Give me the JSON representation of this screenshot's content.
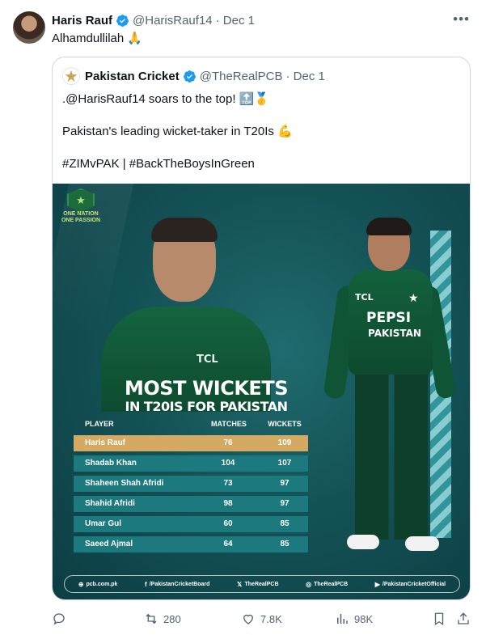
{
  "tweet": {
    "author_name": "Haris Rauf",
    "author_handle": "@HarisRauf14",
    "date": "· Dec 1",
    "text": "Alhamdullilah 🙏",
    "more_icon": "more-icon"
  },
  "quote": {
    "author_name": "Pakistan Cricket",
    "author_handle": "@TheRealPCB",
    "date": "· Dec 1",
    "line1": ".@HarisRauf14 soars to the top! 🔝🥇",
    "line2": "Pakistan's leading wicket-taker in T20Is 💪",
    "line3": "#ZIMvPAK | #BackTheBoysInGreen"
  },
  "graphic": {
    "badge_line1": "One Nation",
    "badge_line2": "One Passion",
    "headline_1": "MOST WICKETS",
    "headline_2": "IN T20IS FOR PAKISTAN",
    "jersey_brand_1": "PEPSI",
    "jersey_brand_2": "PAKISTAN",
    "jersey_sponsor": "TCL",
    "jersey_brand_3": "TCL",
    "jersey_pepsi": "PEPSI",
    "table": {
      "headers": [
        "PLAYER",
        "MATCHES",
        "WICKETS"
      ],
      "rows": [
        {
          "player": "Haris Rauf",
          "matches": "76",
          "wickets": "109"
        },
        {
          "player": "Shadab Khan",
          "matches": "104",
          "wickets": "107"
        },
        {
          "player": "Shaheen Shah Afridi",
          "matches": "73",
          "wickets": "97"
        },
        {
          "player": "Shahid Afridi",
          "matches": "98",
          "wickets": "97"
        },
        {
          "player": "Umar Gul",
          "matches": "60",
          "wickets": "85"
        },
        {
          "player": "Saeed Ajmal",
          "matches": "64",
          "wickets": "85"
        }
      ]
    },
    "footer": {
      "web": "pcb.com.pk",
      "facebook": "/PakistanCricketBoard",
      "x": "TheRealPCB",
      "instagram": "TheRealPCB",
      "youtube": "/PakistanCricketOfficial"
    }
  },
  "actions": {
    "reply_count": "",
    "retweet_count": "280",
    "like_count": "7.8K",
    "views_count": "98K"
  },
  "colors": {
    "verified": "#1d9bf0",
    "highlight_row": "#d4aa62",
    "table_row": "#1c7a7e"
  }
}
